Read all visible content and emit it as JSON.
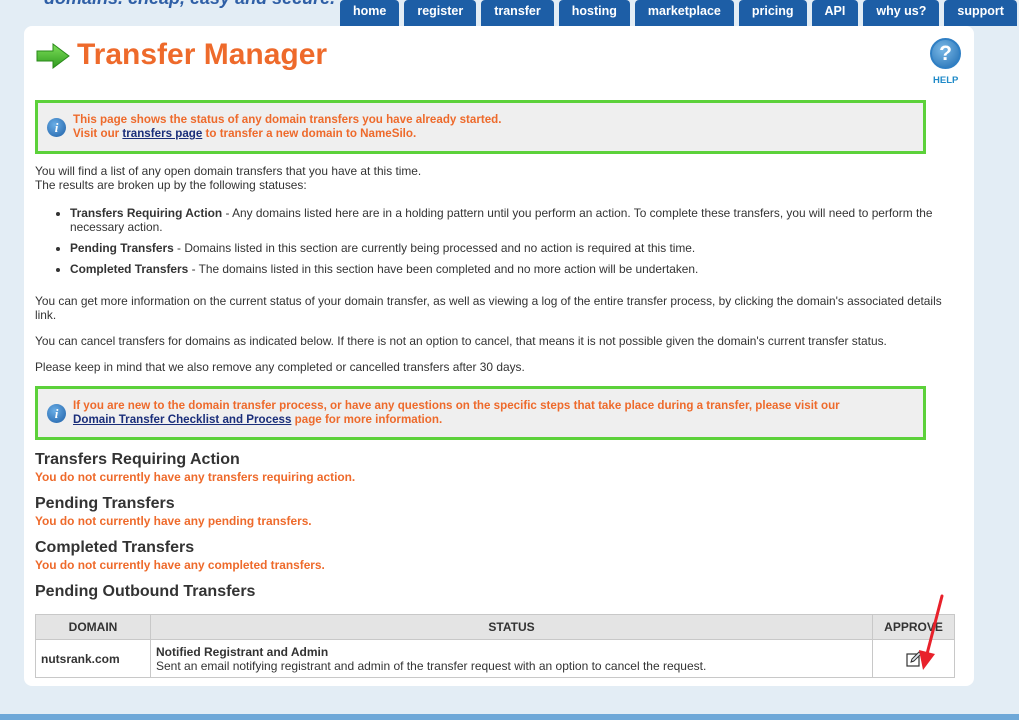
{
  "header": {
    "tagline": "domains. cheap, easy and secure.",
    "nav": [
      "home",
      "register",
      "transfer",
      "hosting",
      "marketplace",
      "pricing",
      "API",
      "why us?",
      "support"
    ]
  },
  "page": {
    "title": "Transfer Manager",
    "help_label": "HELP"
  },
  "notice1": {
    "line1": "This page shows the status of any domain transfers you have already started.",
    "prefix": "Visit our ",
    "link": "transfers page",
    "suffix": " to transfer a new domain to NameSilo."
  },
  "intro": {
    "line1": "You will find a list of any open domain transfers that you have at this time.",
    "line2": "The results are broken up by the following statuses:"
  },
  "statuses": [
    {
      "name": "Transfers Requiring Action",
      "desc": " - Any domains listed here are in a holding pattern until you perform an action. To complete these transfers, you will need to perform the necessary action."
    },
    {
      "name": "Pending Transfers",
      "desc": " - Domains listed in this section are currently being processed and no action is required at this time."
    },
    {
      "name": "Completed Transfers",
      "desc": " - The domains listed in this section have been completed and no more action will be undertaken."
    }
  ],
  "paragraphs": {
    "details": "You can get more information on the current status of your domain transfer, as well as viewing a log of the entire transfer process, by clicking the domain's associated details link.",
    "cancel": "You can cancel transfers for domains as indicated below. If there is not an option to cancel, that means it is not possible given the domain's current transfer status.",
    "removal": "Please keep in mind that we also remove any completed or cancelled transfers after 30 days."
  },
  "notice2": {
    "text": "If you are new to the domain transfer process, or have any questions on the specific steps that take place during a transfer, please visit our",
    "link": "Domain Transfer Checklist and Process",
    "suffix": " page for more information."
  },
  "sections": {
    "requiring_action": {
      "heading": "Transfers Requiring Action",
      "empty": "You do not currently have any transfers requiring action."
    },
    "pending": {
      "heading": "Pending Transfers",
      "empty": "You do not currently have any pending transfers."
    },
    "completed": {
      "heading": "Completed Transfers",
      "empty": "You do not currently have any completed transfers."
    },
    "outbound": {
      "heading": "Pending Outbound Transfers"
    }
  },
  "outbound_table": {
    "headers": [
      "DOMAIN",
      "STATUS",
      "APPROVE"
    ],
    "rows": [
      {
        "domain": "nutsrank.com",
        "status_title": "Notified Registrant and Admin",
        "status_desc": "Sent an email notifying registrant and admin of the transfer request with an option to cancel the request."
      }
    ]
  },
  "colors": {
    "accent_orange": "#ee6a2b",
    "nav_blue": "#1d5ea6",
    "notice_border": "#5cd13a",
    "annotation_red": "#e8212b"
  },
  "icons": [
    "green-arrow-icon",
    "help-icon",
    "info-icon",
    "edit-icon",
    "red-annotation-arrow"
  ]
}
